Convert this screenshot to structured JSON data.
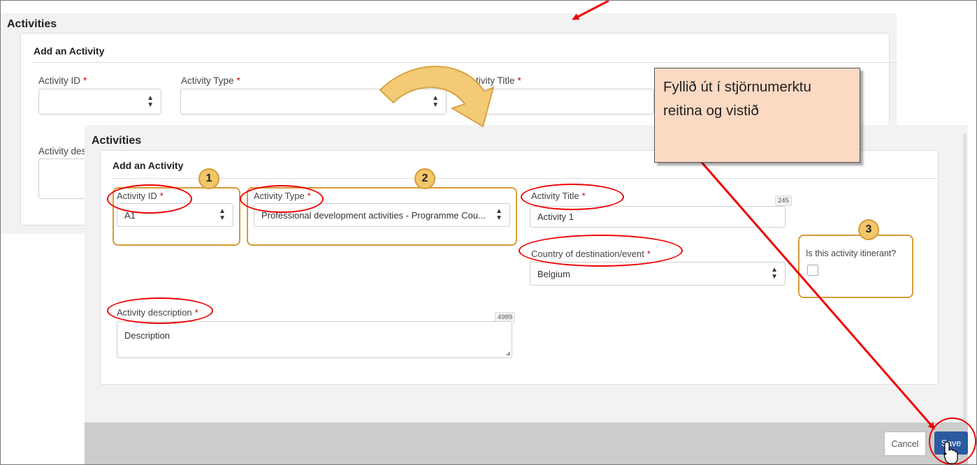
{
  "background_form": {
    "section_title": "Activities",
    "card_title": "Add an Activity",
    "activity_id_label": "Activity ID",
    "activity_type_label": "Activity Type",
    "activity_title_label": "tivity Title",
    "activity_description_label": "Activity des",
    "required_mark": "*"
  },
  "modal": {
    "section_title": "Activities",
    "card_title": "Add an Activity",
    "required_mark": "*",
    "fields": {
      "activity_id": {
        "label": "Activity ID",
        "value": "A1"
      },
      "activity_type": {
        "label": "Activity Type",
        "value": "Professional development activities - Programme Cou..."
      },
      "activity_title": {
        "label": "Activity Title",
        "value": "Activity 1",
        "counter": "245"
      },
      "country": {
        "label": "Country of destination/event",
        "value": "Belgium"
      },
      "itinerant": {
        "label": "Is this activity itinerant?",
        "checked": false
      },
      "description": {
        "label": "Activity description",
        "value": "Description",
        "counter": "4989"
      }
    },
    "buttons": {
      "cancel": "Cancel",
      "save": "Save"
    }
  },
  "annotations": {
    "step_1": "1",
    "step_2": "2",
    "step_3": "3",
    "callout_text": "Fyllið út í stjörnumerktu reitina og vistið",
    "colors": {
      "orange": "#d69b35",
      "red": "#e00000",
      "callout_bg": "#fbd9c3"
    }
  },
  "icons": [
    "select-arrows-icon",
    "resize-grip-icon",
    "hand-cursor-icon",
    "curved-arrow-icon"
  ]
}
